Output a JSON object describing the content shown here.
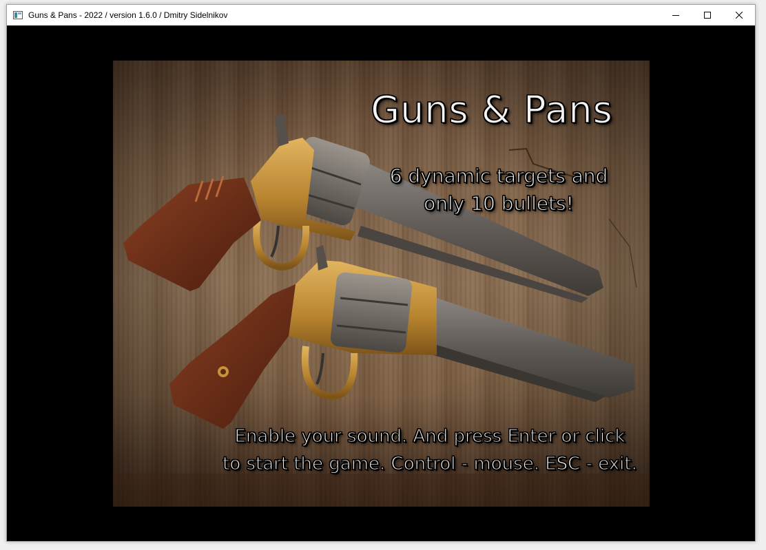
{
  "window": {
    "title": "Guns & Pans - 2022 / version 1.6.0 / Dmitry Sidelnikov",
    "controls": [
      "minimize-icon",
      "maximize-icon",
      "close-icon"
    ]
  },
  "game": {
    "title": "Guns & Pans",
    "tagline": "6 dynamic targets and\nonly 10 bullets!",
    "instructions": "Enable your sound. And press Enter or click\nto start the game. Control - mouse. ESC - exit."
  },
  "colors": {
    "background": "#000000",
    "text_fill": "#f3f3f3",
    "text_outline": "#000000",
    "wood": "#7d6046",
    "brass": "#c7923a"
  }
}
